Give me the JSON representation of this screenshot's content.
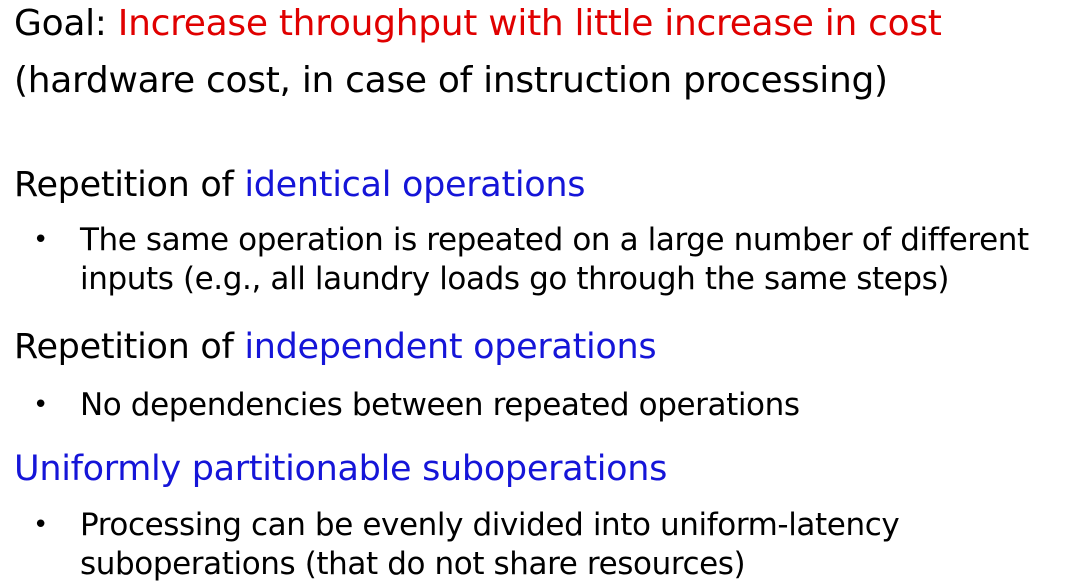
{
  "colors": {
    "red": "#e00000",
    "blue": "#1515d8",
    "text": "#000000"
  },
  "goal": {
    "prefix": "Goal: ",
    "highlight": "Increase throughput with little increase in cost",
    "subtext": "(hardware cost, in case of instruction processing)"
  },
  "sections": [
    {
      "prefix": "Repetition of ",
      "highlight": "identical operations",
      "bullet_lines": [
        "The same operation is repeated on a large number of different",
        "inputs (e.g., all laundry loads go through the same steps)"
      ]
    },
    {
      "prefix": "Repetition of ",
      "highlight": "independent operations",
      "bullet_lines": [
        "No dependencies between repeated operations"
      ]
    },
    {
      "prefix": "",
      "highlight": "Uniformly partitionable suboperations",
      "bullet_lines": [
        "Processing can be evenly divided into uniform-latency",
        "suboperations (that do not share resources)"
      ]
    }
  ],
  "bullet_symbol": "•"
}
